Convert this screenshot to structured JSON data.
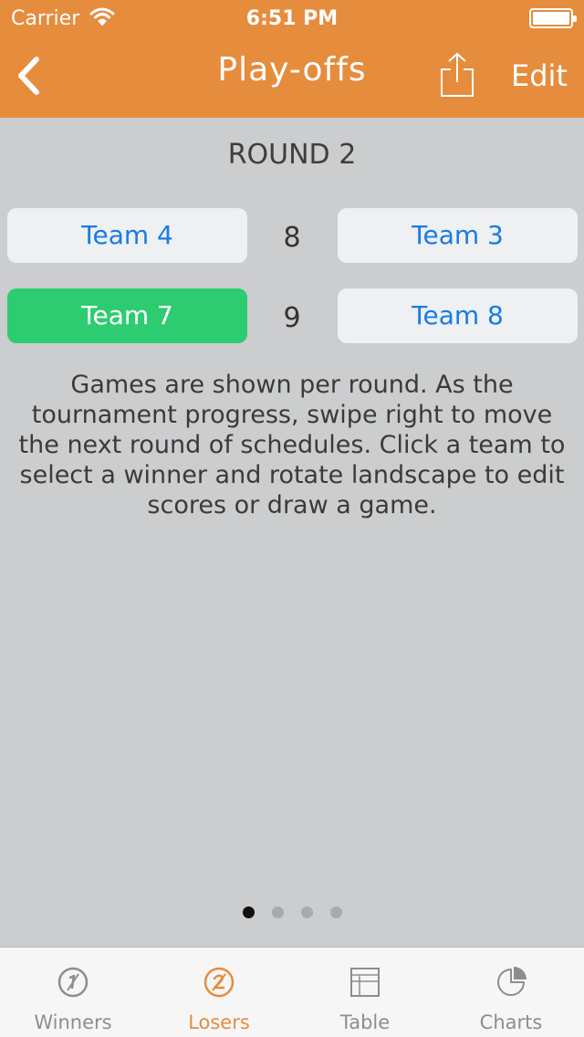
{
  "status_bar": {
    "carrier": "Carrier",
    "time": "6:51 PM"
  },
  "nav": {
    "title": "Play-offs",
    "edit_label": "Edit",
    "back_icon": "chevron-left-icon",
    "share_icon": "share-icon"
  },
  "round": {
    "title": "ROUND 2",
    "matches": [
      {
        "team_a": "Team 4",
        "score": "8",
        "team_b": "Team 3",
        "winner": ""
      },
      {
        "team_a": "Team 7",
        "score": "9",
        "team_b": "Team 8",
        "winner": "Team 7"
      }
    ]
  },
  "instructions": "Games are shown per round. As the tournament progress, swipe right to move the next round of schedules. Click a team to select a winner and rotate landscape to edit scores or draw a game.",
  "pagination": {
    "pages": 4,
    "current": 1
  },
  "tabs": [
    {
      "label": "Winners",
      "icon": "winners-icon",
      "active": false
    },
    {
      "label": "Losers",
      "icon": "losers-icon",
      "active": true
    },
    {
      "label": "Table",
      "icon": "table-icon",
      "active": false
    },
    {
      "label": "Charts",
      "icon": "pie-chart-icon",
      "active": false
    }
  ],
  "colors": {
    "accent": "#e68c3d",
    "winner": "#2ecc71",
    "team_text": "#1a7be2",
    "background": "#cbcdcf"
  }
}
